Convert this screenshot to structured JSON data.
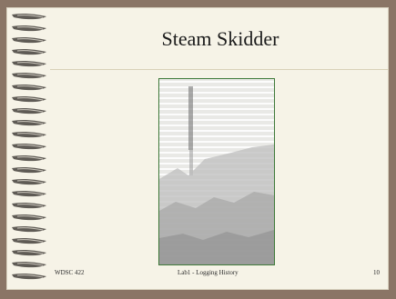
{
  "slide": {
    "title": "Steam Skidder",
    "photo_alt": "steam skidder historical photograph",
    "footer": {
      "course": "WDSC 422",
      "lab": "Lab1 - Logging History",
      "page": "10"
    },
    "colors": {
      "background": "#8a7566",
      "slide": "#f6f3e7",
      "frame": "#3f7a3a"
    }
  }
}
